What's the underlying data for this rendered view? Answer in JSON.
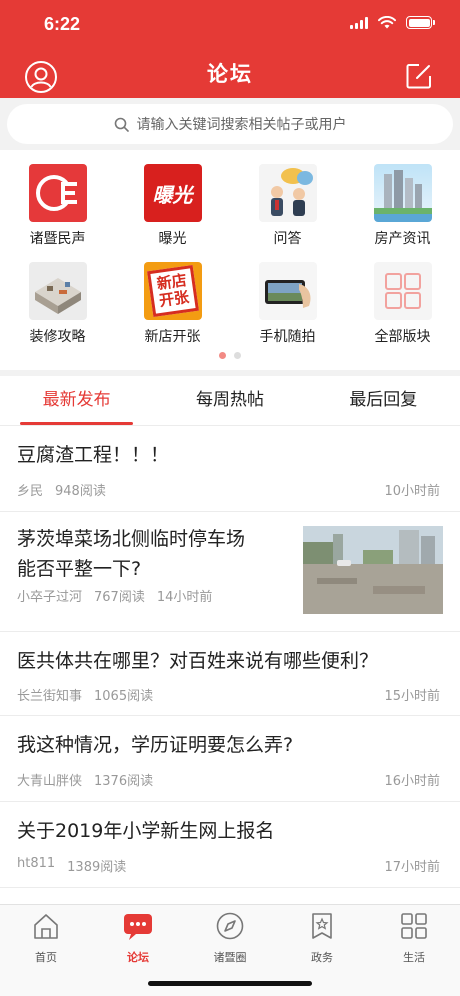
{
  "status_bar": {
    "time": "6:22"
  },
  "header": {
    "title": "论坛"
  },
  "search": {
    "placeholder": "请输入关键词搜索相关帖子或用户"
  },
  "categories": [
    {
      "label": "诸暨民声",
      "icon": "zhuji-voice-icon"
    },
    {
      "label": "曝光",
      "icon": "exposure-icon"
    },
    {
      "label": "问答",
      "icon": "qa-icon"
    },
    {
      "label": "房产资讯",
      "icon": "real-estate-icon"
    },
    {
      "label": "装修攻略",
      "icon": "decoration-icon"
    },
    {
      "label": "新店开张",
      "icon": "new-store-icon"
    },
    {
      "label": "手机随拍",
      "icon": "phone-photo-icon"
    },
    {
      "label": "全部版块",
      "icon": "all-sections-icon"
    }
  ],
  "logo_text": {
    "exposure": "曝光",
    "new_store": "新店开张"
  },
  "tabs": [
    {
      "label": "最新发布",
      "active": true
    },
    {
      "label": "每周热帖",
      "active": false
    },
    {
      "label": "最后回复",
      "active": false
    }
  ],
  "posts": [
    {
      "title": "豆腐渣工程！！！",
      "author": "乡民",
      "views": "948阅读",
      "time": "10小时前"
    },
    {
      "title_line1": "茅茨埠菜场北侧临时停车场",
      "title_line2": "能否平整一下?",
      "author": "小卒子过河",
      "views": "767阅读",
      "time": "14小时前",
      "has_image": true
    },
    {
      "title": "医共体共在哪里？对百姓来说有哪些便利？",
      "author": "长兰街知事",
      "views": "1065阅读",
      "time": "15小时前"
    },
    {
      "title": "我这种情况，学历证明要怎么弄?",
      "author": "大青山胖侠",
      "views": "1376阅读",
      "time": "16小时前"
    },
    {
      "title": "关于2019年小学新生网上报名",
      "author": "ht811",
      "views": "1389阅读",
      "time": "17小时前"
    }
  ],
  "tabbar": [
    {
      "label": "首页",
      "icon": "home-icon",
      "active": false
    },
    {
      "label": "论坛",
      "icon": "forum-icon",
      "active": true
    },
    {
      "label": "诸暨圈",
      "icon": "compass-icon",
      "active": false
    },
    {
      "label": "政务",
      "icon": "gov-icon",
      "active": false
    },
    {
      "label": "生活",
      "icon": "grid-icon",
      "active": false
    }
  ],
  "colors": {
    "brand": "#e53a36",
    "text": "#222222",
    "meta": "#999999"
  }
}
